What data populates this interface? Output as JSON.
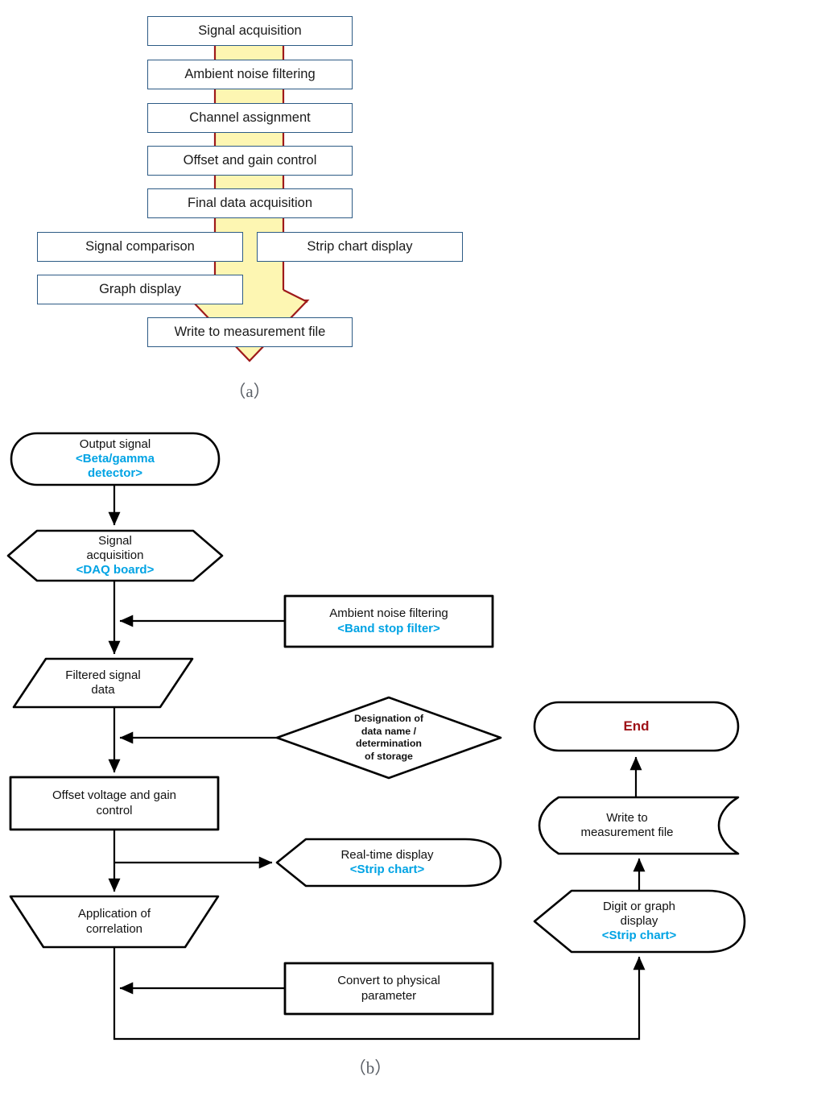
{
  "figure": {
    "panel_a_caption": "（a）",
    "panel_b_caption": "（b）"
  },
  "panel_a": {
    "accent_border": "#2d5b85",
    "arrow_fill": "#fdf6b2",
    "arrow_stroke": "#9e1a1a",
    "boxes": [
      {
        "id": "signal-acquisition",
        "label": "Signal acquisition"
      },
      {
        "id": "ambient-noise-filtering",
        "label": "Ambient noise filtering"
      },
      {
        "id": "channel-assignment",
        "label": "Channel assignment"
      },
      {
        "id": "offset-and-gain-control",
        "label": "Offset and gain control"
      },
      {
        "id": "final-data-acquisition",
        "label": "Final data acquisition"
      },
      {
        "id": "signal-comparison",
        "label": "Signal comparison"
      },
      {
        "id": "strip-chart-display",
        "label": "Strip chart display"
      },
      {
        "id": "graph-display",
        "label": "Graph display"
      },
      {
        "id": "write-to-measurement-file",
        "label": "Write to measurement file"
      }
    ]
  },
  "panel_b": {
    "accent_cyan": "#00a3e4",
    "end_color": "#9e1217",
    "nodes": [
      {
        "id": "output-signal",
        "shape": "terminator",
        "line1": "Output signal",
        "line2": "<Beta/gamma",
        "line3": "detector>"
      },
      {
        "id": "signal-acquisition",
        "shape": "preparation",
        "line1": "Signal",
        "line2": "acquisition",
        "line3": "<DAQ board>"
      },
      {
        "id": "ambient-noise-filtering",
        "shape": "process",
        "line1": "Ambient noise filtering",
        "line2": "<Band stop filter>"
      },
      {
        "id": "filtered-signal-data",
        "shape": "parallelogram",
        "line1": "Filtered signal",
        "line2": "data"
      },
      {
        "id": "designation-of-data-name",
        "shape": "decision",
        "line1": "Designation of",
        "line2": "data name /",
        "line3": "determination",
        "line4": "of storage"
      },
      {
        "id": "end",
        "shape": "terminator",
        "line1": "End"
      },
      {
        "id": "offset-voltage-and-gain-control",
        "shape": "process",
        "line1": "Offset voltage and gain",
        "line2": "control"
      },
      {
        "id": "write-to-measurement-file",
        "shape": "stored-data",
        "line1": "Write to",
        "line2": "measurement file"
      },
      {
        "id": "real-time-display",
        "shape": "display",
        "line1": "Real-time display",
        "line2": "<Strip chart>"
      },
      {
        "id": "application-of-correlation",
        "shape": "trapezoid",
        "line1": "Application of",
        "line2": "correlation"
      },
      {
        "id": "digit-or-graph-display",
        "shape": "display",
        "line1": "Digit or graph",
        "line2": "display",
        "line3": "<Strip chart>"
      },
      {
        "id": "convert-to-physical-parameter",
        "shape": "process",
        "line1": "Convert to physical",
        "line2": "parameter"
      }
    ]
  }
}
